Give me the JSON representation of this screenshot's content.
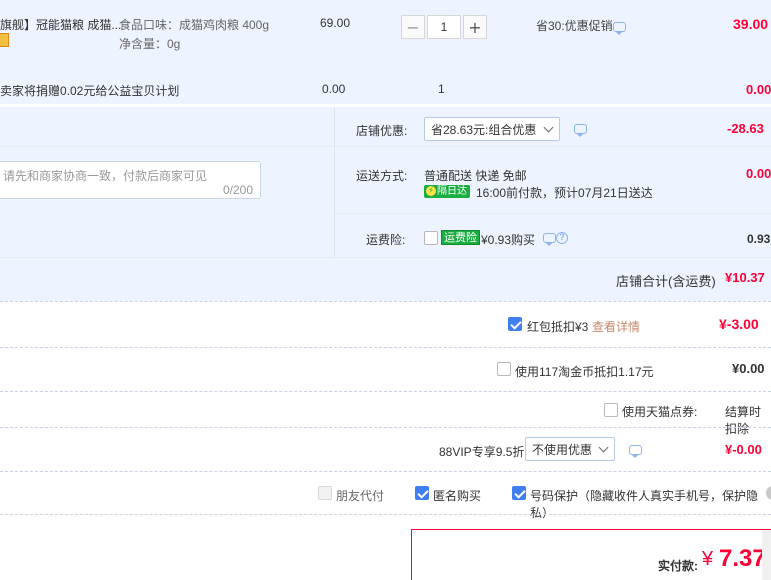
{
  "product": {
    "title": "旗舰】冠能猫粮 成猫...",
    "props": [
      "食品口味：成猫鸡肉粮 400g",
      "净含量：0g"
    ],
    "price": "69.00",
    "quantity": "1",
    "promo": "省30:优惠促销",
    "subtotal": "39.00"
  },
  "charity": {
    "text": "卖家将捐赠0.02元给公益宝贝计划",
    "price": "0.00",
    "quantity": "1",
    "subtotal": "0.00"
  },
  "shop": {
    "message_placeholder": "请先和商家协商一致，付款后商家可见",
    "message_count": "0/200",
    "discount_label": "店铺优惠:",
    "discount_select": "省28.63元:组合优惠",
    "discount_value": "-28.63",
    "shipping_label": "运送方式:",
    "shipping_method": "普通配送 快递 免邮",
    "shipping_badge": "隔日达",
    "shipping_time": "16:00前付款，预计07月21日送达",
    "shipping_value": "0.00",
    "insurance_label": "运费险:",
    "insurance_badge": "运费险",
    "insurance_price": "¥0.93购买",
    "insurance_value": "0.93",
    "total_label": "店铺合计(含运费)",
    "total_value": "¥10.37"
  },
  "deductions": {
    "redpacket_label": "红包抵扣¥3",
    "redpacket_link": "查看详情",
    "redpacket_value": "¥-3.00",
    "taobao_coin_label": "使用117淘金币抵扣1.17元",
    "taobao_coin_value": "¥0.00",
    "tmall_points_label": "使用天猫点券:",
    "tmall_points_value": "结算时扣除",
    "vip_label": "88VIP专享9.5折",
    "vip_select": "不使用优惠",
    "vip_value": "¥-0.00"
  },
  "options": {
    "friend_pay": "朋友代付",
    "anonymous": "匿名购买",
    "number_protect": "号码保护（隐藏收件人真实手机号，保护隐私）"
  },
  "payment": {
    "label": "实付款:",
    "currency": "¥",
    "amount": "7.37"
  },
  "colors": {
    "accent_red": "#ff0036",
    "accent_blue": "#3f7ff1",
    "panel_bg": "#eef4ff"
  }
}
